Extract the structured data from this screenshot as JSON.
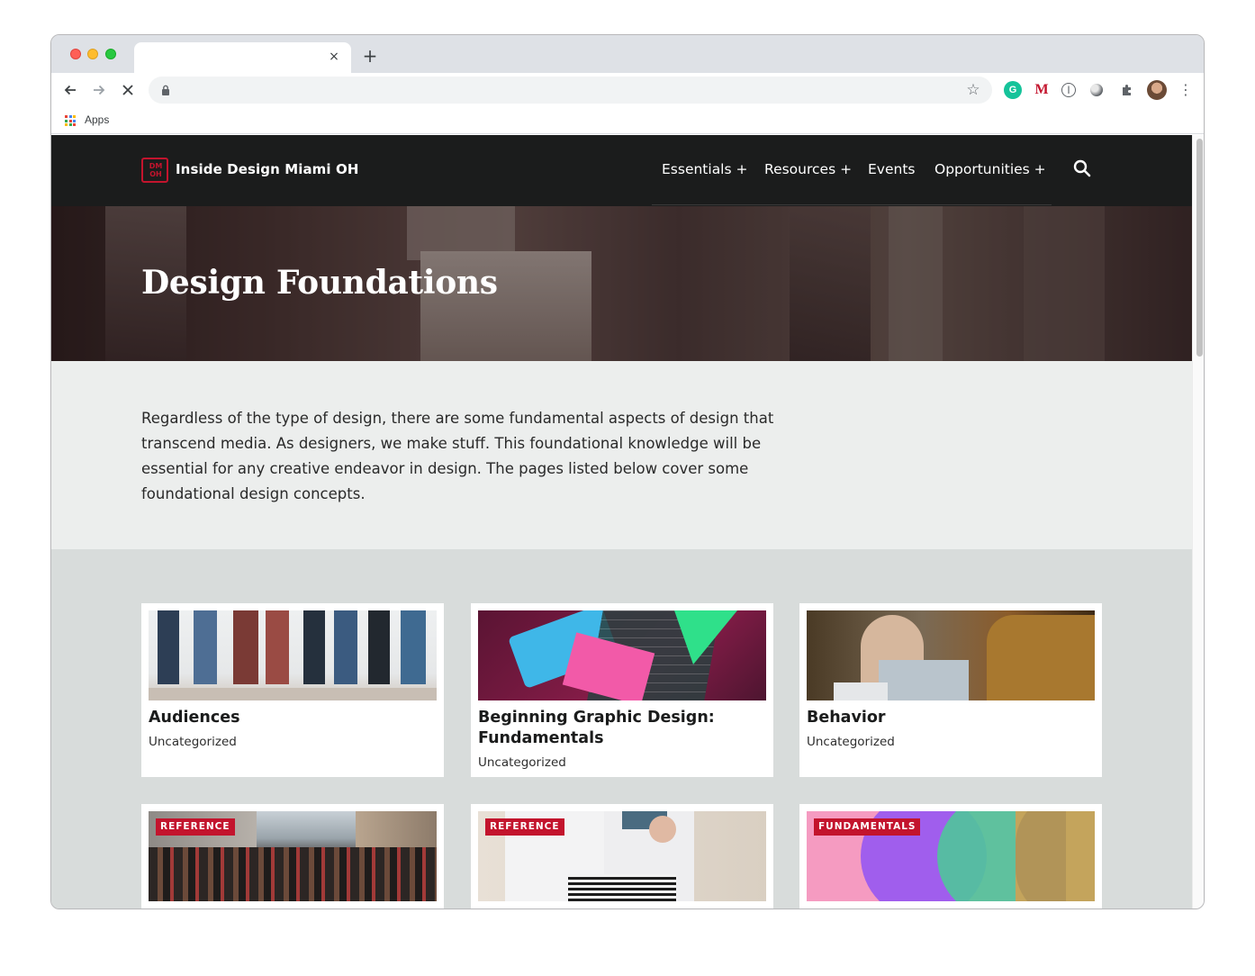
{
  "browser": {
    "tab_close": "×",
    "new_tab": "+",
    "bookmarks": {
      "apps_label": "Apps"
    }
  },
  "site": {
    "logo_text_top": "DM",
    "logo_text_bottom": "OH",
    "title": "Inside Design Miami OH",
    "nav": [
      {
        "label": "Essentials +"
      },
      {
        "label": "Resources +"
      },
      {
        "label": "Events"
      },
      {
        "label": "Opportunities +"
      }
    ]
  },
  "hero": {
    "title": "Design Foundations"
  },
  "intro": {
    "text": "Regardless of the type of design, there are some fundamental aspects of design that transcend media. As designers, we make stuff. This foundational knowledge will be essential for any creative endeavor in design. The pages listed below cover some foundational design concepts."
  },
  "cards": [
    {
      "title": "Audiences",
      "category": "Uncategorized",
      "badge": ""
    },
    {
      "title": "Beginning Graphic Design: Fundamentals",
      "category": "Uncategorized",
      "badge": ""
    },
    {
      "title": "Behavior",
      "category": "Uncategorized",
      "badge": ""
    },
    {
      "title": "",
      "category": "",
      "badge": "REFERENCE"
    },
    {
      "title": "",
      "category": "",
      "badge": "REFERENCE"
    },
    {
      "title": "",
      "category": "",
      "badge": "FUNDAMENTALS"
    }
  ],
  "colors": {
    "brand_red": "#c3142d",
    "header_bg": "#1b1c1c",
    "intro_bg": "#eceeed",
    "grid_bg": "#d8dcdb"
  }
}
